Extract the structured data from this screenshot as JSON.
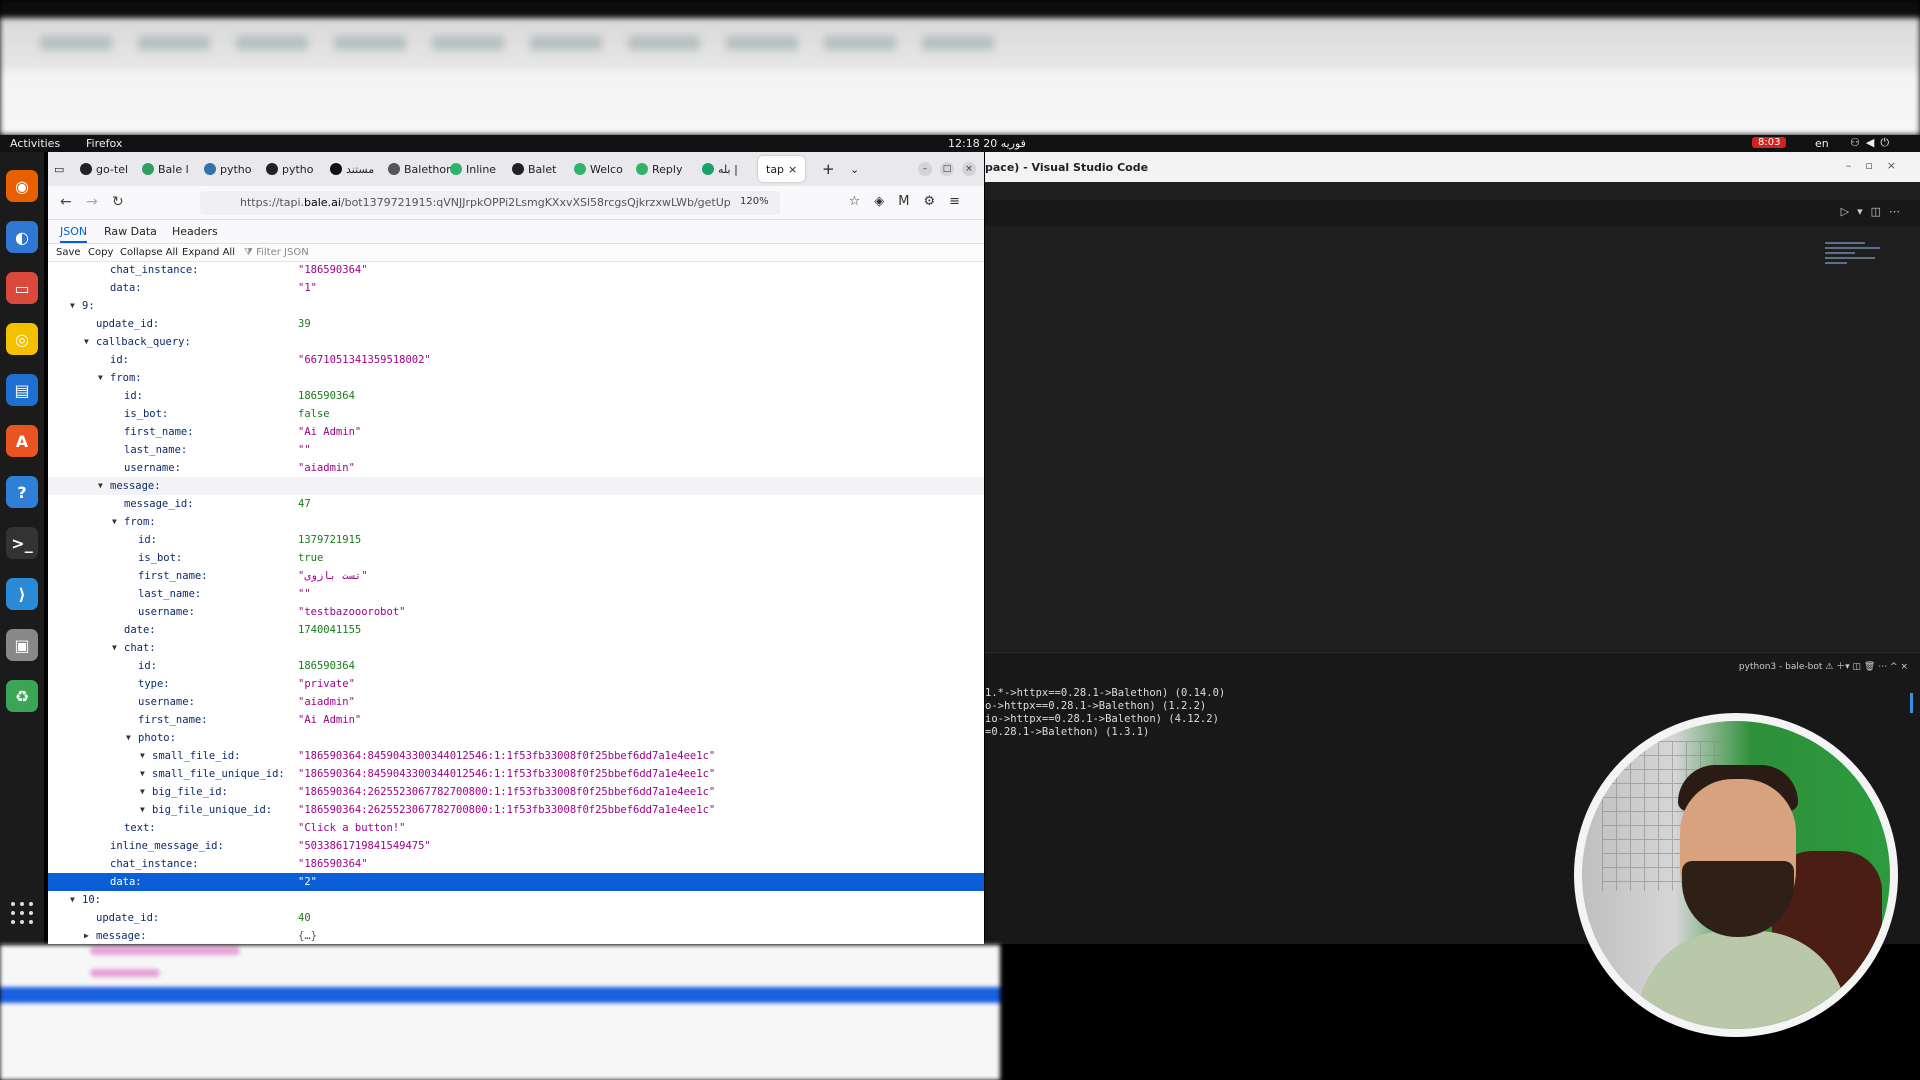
{
  "topbar": {
    "activities": "Activities",
    "app_name": "Firefox",
    "clock": "12:18 فوریه 20",
    "recording": "8:03",
    "lang": "en"
  },
  "dock": {
    "items": [
      "firefox-icon",
      "thunderbird-icon",
      "files-icon",
      "rhythmbox-icon",
      "writer-icon",
      "app-center-icon",
      "help-icon",
      "terminal-icon",
      "vscode-icon",
      "disk-icon",
      "trash-icon"
    ],
    "colors": [
      "#e66000",
      "#2f77d0",
      "#d94a3d",
      "#f2c200",
      "#1f6fd0",
      "#e95420",
      "#2f7fd6",
      "#333333",
      "#2a8ad6",
      "#888888",
      "#3aa655"
    ]
  },
  "browser": {
    "tabs": [
      {
        "label": "go-tel",
        "color": "#222222"
      },
      {
        "label": "Bale l",
        "color": "#2f9f5f"
      },
      {
        "label": "pytho",
        "color": "#3572a5"
      },
      {
        "label": "pytho",
        "color": "#222222"
      },
      {
        "label": "مستند",
        "color": "#111111"
      },
      {
        "label": "Balethon",
        "color": "#555555"
      },
      {
        "label": "Inline",
        "color": "#2fb36b"
      },
      {
        "label": "Balet",
        "color": "#222222"
      },
      {
        "label": "Welco",
        "color": "#2fb36b"
      },
      {
        "label": "Reply",
        "color": "#2fb36b"
      },
      {
        "label": "بله |",
        "color": "#18a36b"
      }
    ],
    "active_tab": "tap",
    "url_prefix": "https://tapi.",
    "url_host": "bale.ai",
    "url_rest": "/bot1379721915:qVNJJrpkOPPi2LsmgKXxvXSl58rcgsQjkrzxwLWb/getUp",
    "zoom": "120%",
    "viewer_tabs": [
      "JSON",
      "Raw Data",
      "Headers"
    ],
    "toolbar": [
      "Save",
      "Copy",
      "Collapse All",
      "Expand All"
    ],
    "filter_placeholder": "Filter JSON"
  },
  "json_rows": [
    {
      "key": "chat_instance:",
      "val": "\"186590364\"",
      "type": "string",
      "indent": 3,
      "twisty": ""
    },
    {
      "key": "data:",
      "val": "\"1\"",
      "type": "string",
      "indent": 3,
      "twisty": ""
    },
    {
      "key": "9:",
      "val": "",
      "type": "",
      "indent": 1,
      "twisty": "open"
    },
    {
      "key": "update_id:",
      "val": "39",
      "type": "number",
      "indent": 2,
      "twisty": ""
    },
    {
      "key": "callback_query:",
      "val": "",
      "type": "",
      "indent": 2,
      "twisty": "open"
    },
    {
      "key": "id:",
      "val": "\"6671051341359518002\"",
      "type": "string",
      "indent": 3,
      "twisty": ""
    },
    {
      "key": "from:",
      "val": "",
      "type": "",
      "indent": 3,
      "twisty": "open"
    },
    {
      "key": "id:",
      "val": "186590364",
      "type": "number",
      "indent": 4,
      "twisty": ""
    },
    {
      "key": "is_bot:",
      "val": "false",
      "type": "bool",
      "indent": 4,
      "twisty": ""
    },
    {
      "key": "first_name:",
      "val": "\"Ai Admin\"",
      "type": "string",
      "indent": 4,
      "twisty": ""
    },
    {
      "key": "last_name:",
      "val": "\"\"",
      "type": "string",
      "indent": 4,
      "twisty": ""
    },
    {
      "key": "username:",
      "val": "\"aiadmin\"",
      "type": "string",
      "indent": 4,
      "twisty": ""
    },
    {
      "key": "message:",
      "val": "",
      "type": "",
      "indent": 3,
      "twisty": "open",
      "hover": true
    },
    {
      "key": "message_id:",
      "val": "47",
      "type": "number",
      "indent": 4,
      "twisty": ""
    },
    {
      "key": "from:",
      "val": "",
      "type": "",
      "indent": 4,
      "twisty": "open"
    },
    {
      "key": "id:",
      "val": "1379721915",
      "type": "number",
      "indent": 5,
      "twisty": ""
    },
    {
      "key": "is_bot:",
      "val": "true",
      "type": "bool",
      "indent": 5,
      "twisty": ""
    },
    {
      "key": "first_name:",
      "val": "\"تست بازوی\"",
      "type": "string",
      "indent": 5,
      "twisty": ""
    },
    {
      "key": "last_name:",
      "val": "\"\"",
      "type": "string",
      "indent": 5,
      "twisty": ""
    },
    {
      "key": "username:",
      "val": "\"testbazooorobot\"",
      "type": "string",
      "indent": 5,
      "twisty": ""
    },
    {
      "key": "date:",
      "val": "1740041155",
      "type": "number",
      "indent": 4,
      "twisty": ""
    },
    {
      "key": "chat:",
      "val": "",
      "type": "",
      "indent": 4,
      "twisty": "open"
    },
    {
      "key": "id:",
      "val": "186590364",
      "type": "number",
      "indent": 5,
      "twisty": ""
    },
    {
      "key": "type:",
      "val": "\"private\"",
      "type": "string",
      "indent": 5,
      "twisty": ""
    },
    {
      "key": "username:",
      "val": "\"aiadmin\"",
      "type": "string",
      "indent": 5,
      "twisty": ""
    },
    {
      "key": "first_name:",
      "val": "\"Ai Admin\"",
      "type": "string",
      "indent": 5,
      "twisty": ""
    },
    {
      "key": "photo:",
      "val": "",
      "type": "",
      "indent": 5,
      "twisty": "open"
    },
    {
      "key": "small_file_id:",
      "val": "\"186590364:8459043300344012546:1:1f53fb33008f0f25bbef6dd7a1e4ee1c\"",
      "type": "string",
      "indent": 6,
      "twisty": "open"
    },
    {
      "key": "small_file_unique_id:",
      "val": "\"186590364:8459043300344012546:1:1f53fb33008f0f25bbef6dd7a1e4ee1c\"",
      "type": "string",
      "indent": 6,
      "twisty": "open"
    },
    {
      "key": "big_file_id:",
      "val": "\"186590364:2625523067782700800:1:1f53fb33008f0f25bbef6dd7a1e4ee1c\"",
      "type": "string",
      "indent": 6,
      "twisty": "open"
    },
    {
      "key": "big_file_unique_id:",
      "val": "\"186590364:2625523067782700800:1:1f53fb33008f0f25bbef6dd7a1e4ee1c\"",
      "type": "string",
      "indent": 6,
      "twisty": "open"
    },
    {
      "key": "text:",
      "val": "\"Click a button!\"",
      "type": "string",
      "indent": 4,
      "twisty": ""
    },
    {
      "key": "inline_message_id:",
      "val": "\"5033861719841549475\"",
      "type": "string",
      "indent": 3,
      "twisty": ""
    },
    {
      "key": "chat_instance:",
      "val": "\"186590364\"",
      "type": "string",
      "indent": 3,
      "twisty": ""
    },
    {
      "key": "data:",
      "val": "\"2\"",
      "type": "string",
      "indent": 3,
      "twisty": "",
      "selected": true
    },
    {
      "key": "10:",
      "val": "",
      "type": "",
      "indent": 1,
      "twisty": "open"
    },
    {
      "key": "update_id:",
      "val": "40",
      "type": "number",
      "indent": 2,
      "twisty": ""
    },
    {
      "key": "message:",
      "val": "{…}",
      "type": "obj",
      "indent": 2,
      "twisty": "closed"
    }
  ],
  "vscode": {
    "title": "pace) - Visual Studio Code",
    "terminal_label": "python3 - bale-bot",
    "terminal_lines": [
      "1.*->httpx==0.28.1->Balethon) (0.14.0)",
      "o->httpx==0.28.1->Balethon) (1.2.2)",
      "io->httpx==0.28.1->Balethon) (4.12.2)",
      "=0.28.1->Balethon) (1.3.1)"
    ]
  }
}
